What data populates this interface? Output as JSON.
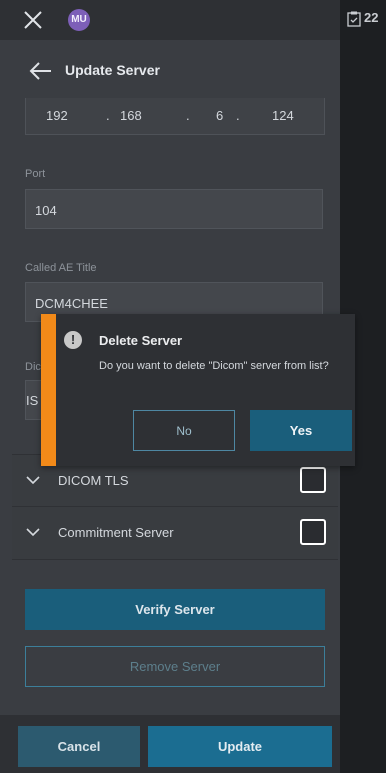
{
  "topbar": {
    "avatar_initials": "MU"
  },
  "right_strip": {
    "text": "22"
  },
  "header": {
    "title": "Update Server"
  },
  "ip": {
    "parts": [
      "192",
      "168",
      "6",
      "124"
    ],
    "separator": "."
  },
  "port": {
    "label": "Port",
    "value": "104"
  },
  "called_ae": {
    "label": "Called AE Title",
    "value": "DCM4CHEE"
  },
  "hidden_field": {
    "label_fragment": "Dic",
    "value_fragment": "IS"
  },
  "sections": [
    {
      "label": "DICOM TLS",
      "checked": false
    },
    {
      "label": "Commitment Server",
      "checked": false
    }
  ],
  "buttons": {
    "verify": "Verify Server",
    "remove": "Remove Server",
    "cancel": "Cancel",
    "update": "Update"
  },
  "dialog": {
    "title": "Delete Server",
    "message": "Do you want to delete \"Dicom\" server from list?",
    "no": "No",
    "yes": "Yes",
    "accent_color": "#f28a19"
  },
  "colors": {
    "primary_button": "#1a5e7b",
    "update_button": "#1b6d91"
  }
}
